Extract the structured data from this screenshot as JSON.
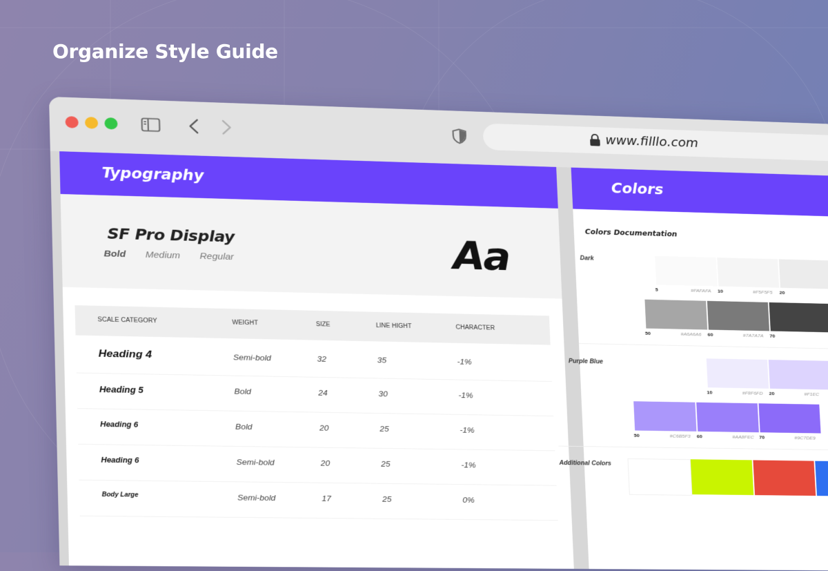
{
  "headline": "Organize Style Guide",
  "browser": {
    "url": "www.filllo.com"
  },
  "typography": {
    "title": "Typography",
    "font_name": "SF Pro Display",
    "weights": [
      "Bold",
      "Medium",
      "Regular"
    ],
    "sample": "Aa",
    "table": {
      "headers": [
        "SCALE CATEGORY",
        "WEIGHT",
        "SIZE",
        "LINE HIGHT",
        "CHARACTER"
      ],
      "rows": [
        [
          "Heading 4",
          "Semi-bold",
          "32",
          "35",
          "-1%"
        ],
        [
          "Heading 5",
          "Bold",
          "24",
          "30",
          "-1%"
        ],
        [
          "Heading 6",
          "Bold",
          "20",
          "25",
          "-1%"
        ],
        [
          "Heading 6",
          "Semi-bold",
          "20",
          "25",
          "-1%"
        ],
        [
          "Body Large",
          "Semi-bold",
          "17",
          "25",
          "0%"
        ]
      ]
    }
  },
  "colors": {
    "title": "Colors",
    "documentation": "Colors Documentation",
    "groups": [
      {
        "label": "Dark",
        "swatches": [
          {
            "num": "5",
            "hex": "#FAFAFA",
            "color": "#fafafa"
          },
          {
            "num": "10",
            "hex": "#F5F5F5",
            "color": "#f5f5f5"
          },
          {
            "num": "20",
            "hex": "",
            "color": "#ececec"
          },
          {
            "num": "50",
            "hex": "#A6A6A6",
            "color": "#a6a6a6"
          },
          {
            "num": "60",
            "hex": "#7A7A7A",
            "color": "#7a7a7a"
          },
          {
            "num": "70",
            "hex": "",
            "color": "#444444"
          }
        ]
      },
      {
        "label": "Purple Blue",
        "swatches": [
          {
            "num": "10",
            "hex": "#F8F6FD",
            "color": "#eeebfd"
          },
          {
            "num": "20",
            "hex": "#F1EC",
            "color": "#ddd4fe"
          },
          {
            "num": "50",
            "hex": "#C6B5F3",
            "color": "#ab97fb"
          },
          {
            "num": "60",
            "hex": "#AA8FEC",
            "color": "#9a7ffa"
          },
          {
            "num": "70",
            "hex": "#9C7DE9",
            "color": "#8c6bf9"
          }
        ]
      },
      {
        "label": "Additional Colors",
        "swatches": [
          {
            "num": "",
            "hex": "",
            "color": "#ffffff"
          },
          {
            "num": "",
            "hex": "",
            "color": "#c9f400"
          },
          {
            "num": "",
            "hex": "",
            "color": "#e64a3b"
          },
          {
            "num": "",
            "hex": "",
            "color": "#2e6ff0"
          }
        ]
      }
    ]
  },
  "accent": "#6a43fb"
}
